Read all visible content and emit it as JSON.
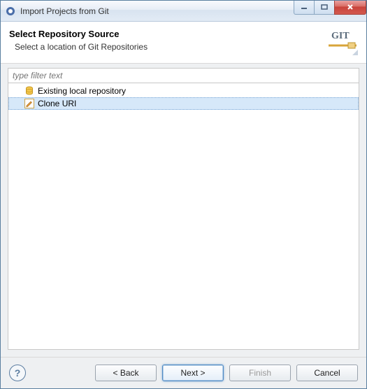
{
  "window": {
    "title": "Import Projects from Git"
  },
  "header": {
    "heading": "Select Repository Source",
    "description": "Select a location of Git Repositories",
    "logo_text": "GIT"
  },
  "filter": {
    "placeholder": "type filter text",
    "value": ""
  },
  "tree": {
    "items": [
      {
        "label": "Existing local repository",
        "icon": "database-icon",
        "selected": false
      },
      {
        "label": "Clone URI",
        "icon": "edit-icon",
        "selected": true
      }
    ]
  },
  "buttons": {
    "help": "?",
    "back": "< Back",
    "next": "Next >",
    "finish": "Finish",
    "cancel": "Cancel"
  }
}
